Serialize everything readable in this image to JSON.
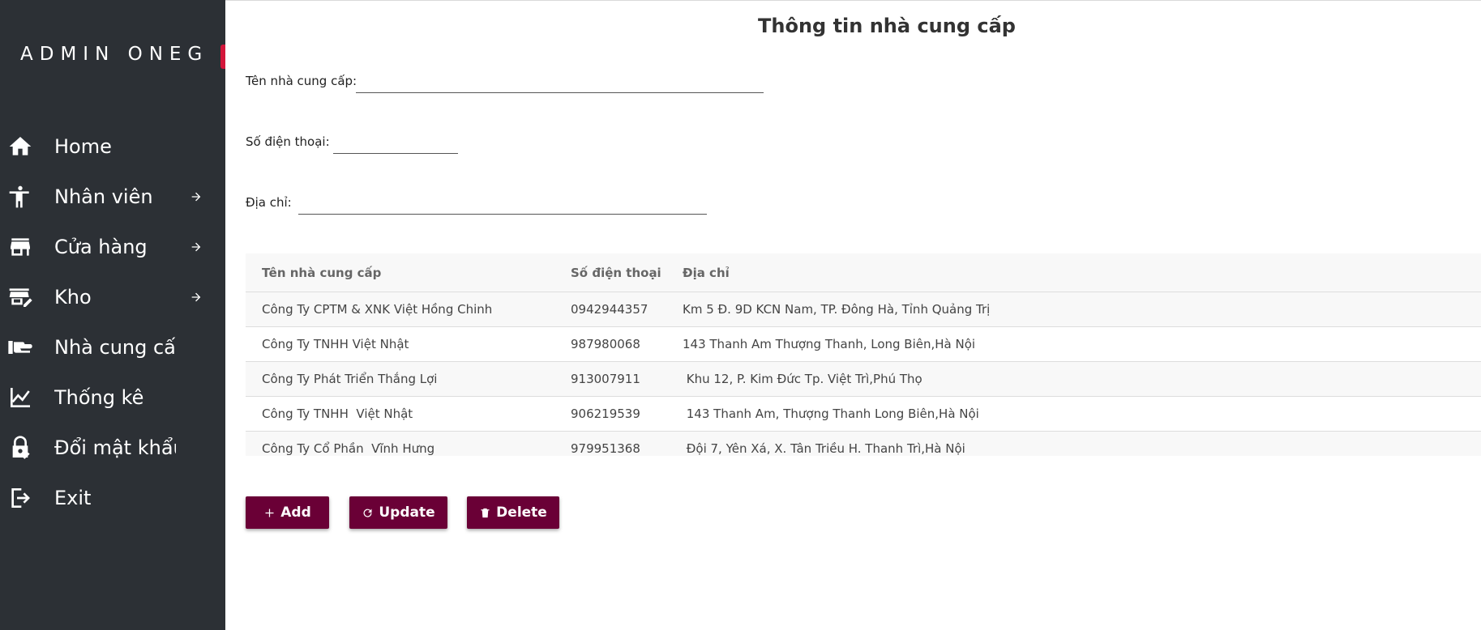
{
  "app": {
    "brand": "ADMIN ONEG"
  },
  "sidebar": {
    "items": [
      {
        "label": "Home",
        "icon": "home-icon",
        "has_arrow": false
      },
      {
        "label": "Nhân viên",
        "icon": "person-icon",
        "has_arrow": true
      },
      {
        "label": "Cửa hàng",
        "icon": "store-icon",
        "has_arrow": true
      },
      {
        "label": "Kho",
        "icon": "warehouse-icon",
        "has_arrow": true
      },
      {
        "label": "Nhà cung cấp",
        "icon": "hand-icon",
        "has_arrow": false
      },
      {
        "label": "Thống kê",
        "icon": "chart-icon",
        "has_arrow": false
      },
      {
        "label": "Đổi mật khẩu",
        "icon": "lock-icon",
        "has_arrow": false
      },
      {
        "label": "Exit",
        "icon": "exit-icon",
        "has_arrow": false
      }
    ]
  },
  "page": {
    "title": "Thông tin nhà cung cấp"
  },
  "form": {
    "name_label": "Tên nhà cung cấp:",
    "name_value": "",
    "phone_label": "Số điện thoại:",
    "phone_value": "",
    "address_label": "Địa chỉ:",
    "address_value": ""
  },
  "table": {
    "headers": [
      "Tên nhà cung cấp",
      "Số điện thoại",
      "Địa chỉ"
    ],
    "rows": [
      [
        "Công Ty CPTM & XNK Việt Hồng Chinh",
        "0942944357",
        "Km 5 Đ. 9D KCN Nam, TP. Đông Hà, Tỉnh Quảng Trị"
      ],
      [
        "Công Ty TNHH Việt Nhật",
        "987980068",
        "143 Thanh Am Thượng Thanh, Long Biên,Hà Nội"
      ],
      [
        "Công Ty Phát Triển Thắng Lợi",
        "913007911",
        " Khu 12, P. Kim Đức Tp. Việt Trì,Phú Thọ"
      ],
      [
        "Công Ty TNHH  Việt Nhật",
        "906219539",
        " 143 Thanh Am, Thượng Thanh Long Biên,Hà Nội"
      ],
      [
        "Công Ty Cổ Phần  Vĩnh Hưng",
        "979951368",
        " Đội 7, Yên Xá, X. Tân Triều H. Thanh Trì,Hà Nội"
      ]
    ]
  },
  "actions": {
    "add_label": "Add",
    "update_label": "Update",
    "delete_label": "Delete"
  },
  "colors": {
    "sidebar_bg": "#2c3035",
    "accent": "#d3163a",
    "button_bg": "#6a0036"
  }
}
